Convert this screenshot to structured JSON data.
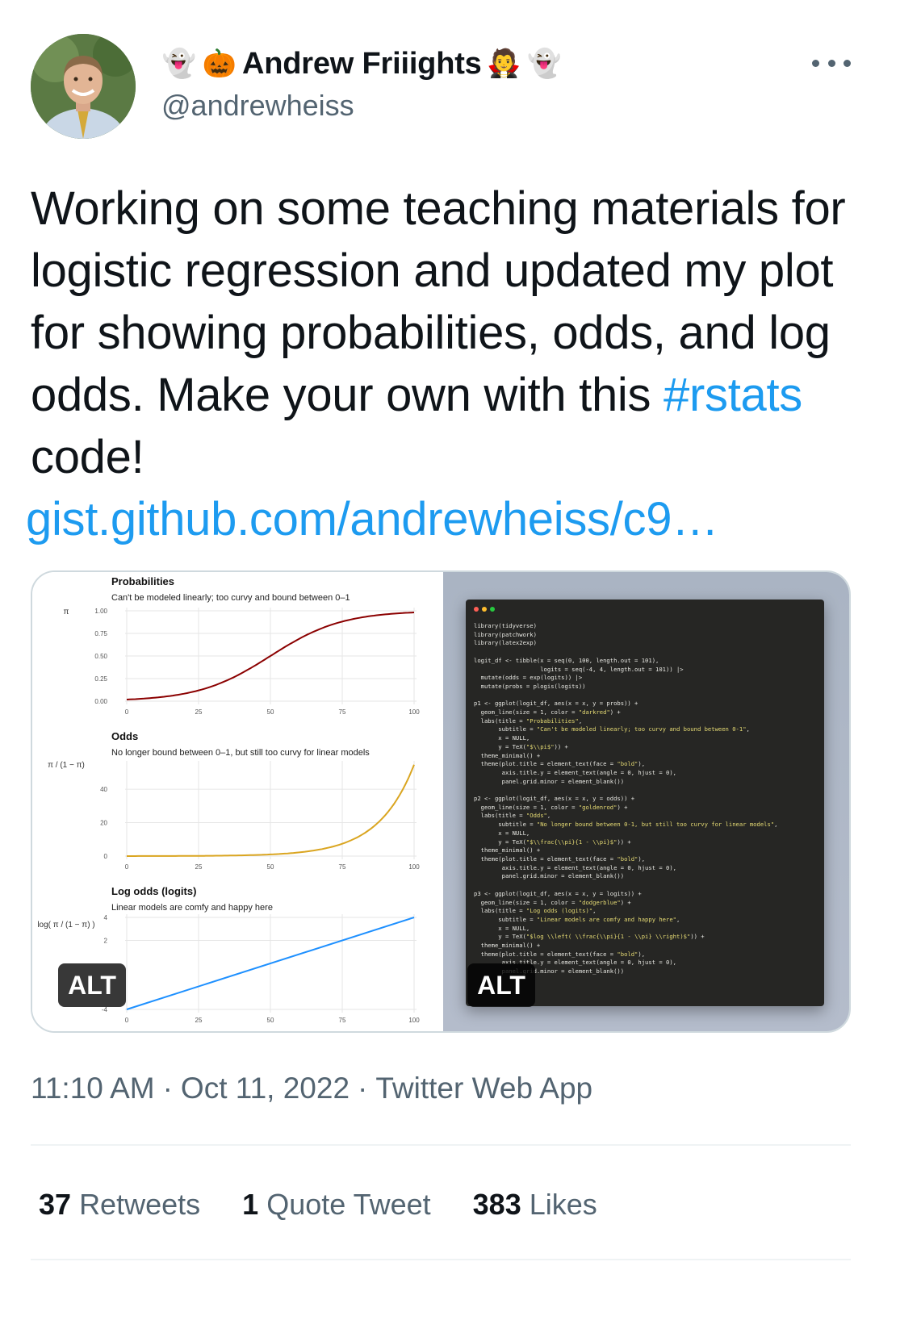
{
  "author": {
    "display_name": "Andrew Friiights",
    "handle": "@andrewheiss",
    "emoji_left": [
      "👻",
      "🎃"
    ],
    "emoji_right": [
      "🧛",
      "👻"
    ]
  },
  "tweet": {
    "text_before_hashtag": "Working on some teaching materials for logistic regression and updated my plot for showing probabilities, odds, and log odds. Make your own with this ",
    "hashtag": "#rstats",
    "text_after_hashtag": " code!",
    "link": "gist.github.com/andrewheiss/c9…"
  },
  "media": {
    "alt_badge_left": "ALT",
    "alt_badge_right": "ALT",
    "code_lines": [
      "library(tidyverse)",
      "library(patchwork)",
      "library(latex2exp)",
      "",
      "logit_df <- tibble(x = seq(0, 100, length.out = 101),",
      "                   logits = seq(-4, 4, length.out = 101)) |>",
      "  mutate(odds = exp(logits)) |>",
      "  mutate(probs = plogis(logits))",
      "",
      "p1 <- ggplot(logit_df, aes(x = x, y = probs)) +",
      "  geom_line(size = 1, color = \"darkred\") +",
      "  labs(title = \"Probabilities\",",
      "       subtitle = \"Can't be modeled linearly; too curvy and bound between 0-1\",",
      "       x = NULL,",
      "       y = TeX(\"$\\\\pi$\")) +",
      "  theme_minimal() +",
      "  theme(plot.title = element_text(face = \"bold\"),",
      "        axis.title.y = element_text(angle = 0, hjust = 0),",
      "        panel.grid.minor = element_blank())",
      "",
      "p2 <- ggplot(logit_df, aes(x = x, y = odds)) +",
      "  geom_line(size = 1, color = \"goldenrod\") +",
      "  labs(title = \"Odds\",",
      "       subtitle = \"No longer bound between 0-1, but still too curvy for linear models\",",
      "       x = NULL,",
      "       y = TeX(\"$\\\\frac{\\\\pi}{1 - \\\\pi}$\")) +",
      "  theme_minimal() +",
      "  theme(plot.title = element_text(face = \"bold\"),",
      "        axis.title.y = element_text(angle = 0, hjust = 0),",
      "        panel.grid.minor = element_blank())",
      "",
      "p3 <- ggplot(logit_df, aes(x = x, y = logits)) +",
      "  geom_line(size = 1, color = \"dodgerblue\") +",
      "  labs(title = \"Log odds (logits)\",",
      "       subtitle = \"Linear models are comfy and happy here\",",
      "       x = NULL,",
      "       y = TeX(\"$log \\\\left( \\\\frac{\\\\pi}{1 - \\\\pi} \\\\right)$\")) +",
      "  theme_minimal() +",
      "  theme(plot.title = element_text(face = \"bold\"),",
      "        axis.title.y = element_text(angle = 0, hjust = 0),",
      "        panel.grid.minor = element_blank())"
    ]
  },
  "chart_data": [
    {
      "type": "line",
      "title": "Probabilities",
      "subtitle": "Can't be modeled linearly; too curvy and bound between 0–1",
      "ylabel": "π",
      "x_ticks": [
        "0",
        "25",
        "50",
        "75",
        "100"
      ],
      "y_ticks": [
        "0.00",
        "0.25",
        "0.50",
        "0.75",
        "1.00"
      ],
      "xlim": [
        0,
        100
      ],
      "ylim": [
        0,
        1
      ],
      "color": "#8b0000",
      "series": [
        {
          "x": [
            0,
            10,
            20,
            30,
            40,
            50,
            60,
            70,
            80,
            90,
            100
          ],
          "y": [
            0.018,
            0.039,
            0.083,
            0.168,
            0.31,
            0.5,
            0.69,
            0.832,
            0.917,
            0.961,
            0.982
          ]
        }
      ]
    },
    {
      "type": "line",
      "title": "Odds",
      "subtitle": "No longer bound between 0–1, but still too curvy for linear models",
      "ylabel": "π / (1 − π)",
      "x_ticks": [
        "0",
        "25",
        "50",
        "75",
        "100"
      ],
      "y_ticks": [
        "0",
        "20",
        "40"
      ],
      "xlim": [
        0,
        100
      ],
      "ylim": [
        0,
        55
      ],
      "color": "#daa520",
      "series": [
        {
          "x": [
            0,
            10,
            20,
            30,
            40,
            50,
            60,
            70,
            80,
            90,
            100
          ],
          "y": [
            0.018,
            0.041,
            0.091,
            0.202,
            0.449,
            1.0,
            2.23,
            4.95,
            11.0,
            24.5,
            54.6
          ]
        }
      ]
    },
    {
      "type": "line",
      "title": "Log odds (logits)",
      "subtitle": "Linear models are comfy and happy here",
      "ylabel": "log( π / (1 − π) )",
      "x_ticks": [
        "0",
        "25",
        "50",
        "75",
        "100"
      ],
      "y_ticks": [
        "-4",
        "2",
        "4"
      ],
      "xlim": [
        0,
        100
      ],
      "ylim": [
        -4,
        4
      ],
      "color": "#1e90ff",
      "series": [
        {
          "x": [
            0,
            100
          ],
          "y": [
            -4,
            4
          ]
        }
      ]
    }
  ],
  "timestamp": {
    "time": "11:10 AM",
    "sep1": "·",
    "date": "Oct 11, 2022",
    "sep2": "·",
    "source": "Twitter Web App"
  },
  "stats": {
    "retweets_count": "37",
    "retweets_label": "Retweets",
    "quotes_count": "1",
    "quotes_label": "Quote Tweet",
    "likes_count": "383",
    "likes_label": "Likes"
  },
  "colors": {
    "link": "#1d9bf0",
    "secondary_text": "#536471",
    "primary_text": "#0f1419"
  }
}
